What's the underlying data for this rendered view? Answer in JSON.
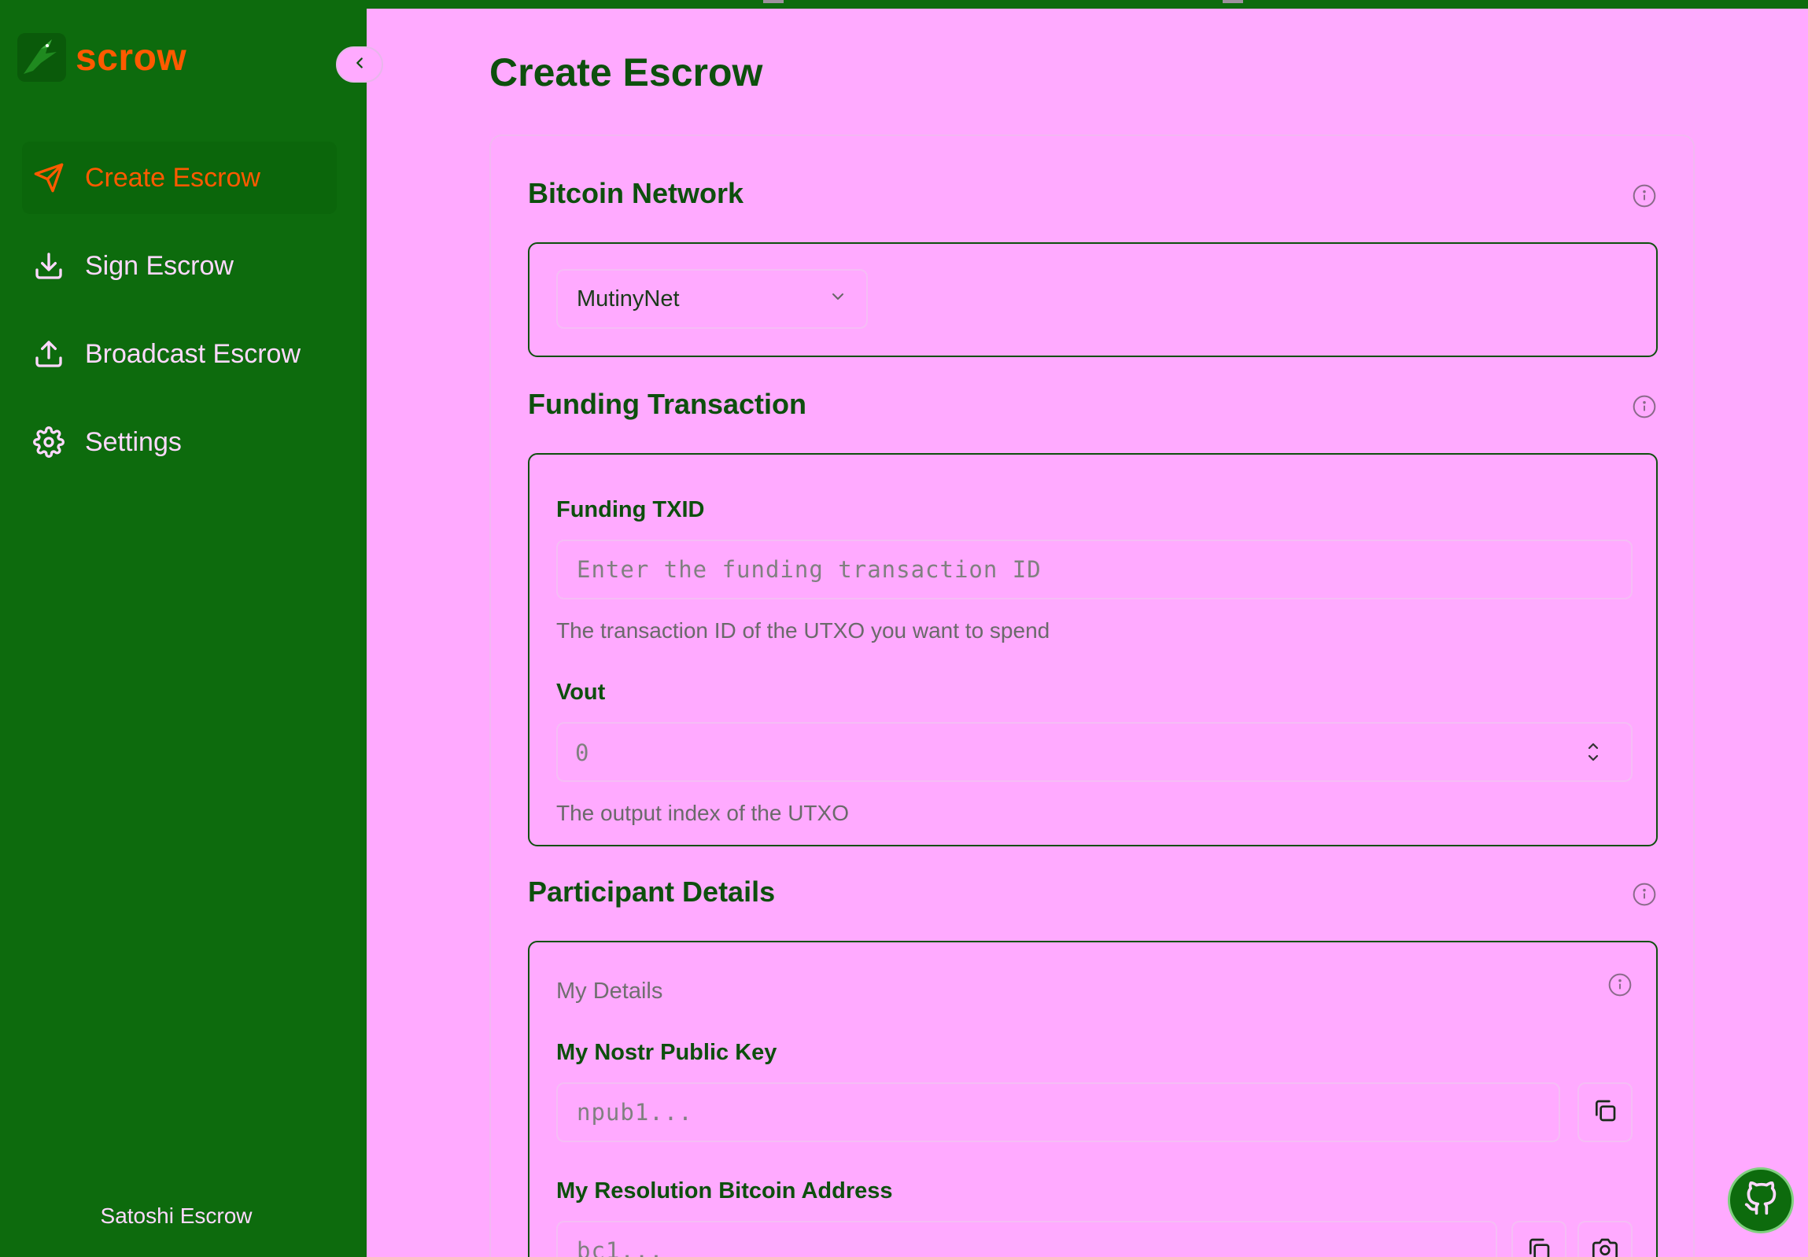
{
  "colors": {
    "sidebar_bg": "#0D6B0D",
    "main_bg": "#FFAAFF",
    "accent": "#FF5A00",
    "heading": "#0D4F0D"
  },
  "brand": {
    "name": "scrow",
    "logo_icon": "bird-logo-icon"
  },
  "sidebar": {
    "collapse_icon": "chevron-left-icon",
    "items": [
      {
        "label": "Create Escrow",
        "icon": "send-icon",
        "active": true
      },
      {
        "label": "Sign Escrow",
        "icon": "download-icon",
        "active": false
      },
      {
        "label": "Broadcast Escrow",
        "icon": "upload-icon",
        "active": false
      },
      {
        "label": "Settings",
        "icon": "gear-icon",
        "active": false
      }
    ],
    "footer": "Satoshi Escrow"
  },
  "main": {
    "title": "Create Escrow",
    "network": {
      "title": "Bitcoin Network",
      "selected": "MutinyNet"
    },
    "funding": {
      "title": "Funding Transaction",
      "txid_label": "Funding TXID",
      "txid_placeholder": "Enter the funding transaction ID",
      "txid_help": "The transaction ID of the UTXO you want to spend",
      "vout_label": "Vout",
      "vout_value": "0",
      "vout_help": "The output index of the UTXO"
    },
    "participants": {
      "title": "Participant Details",
      "my_details_label": "My Details",
      "nostr_label": "My Nostr Public Key",
      "nostr_placeholder": "npub1...",
      "resolution_label": "My Resolution Bitcoin Address",
      "resolution_placeholder": "bc1..."
    }
  },
  "fab": {
    "icon": "github-icon"
  }
}
